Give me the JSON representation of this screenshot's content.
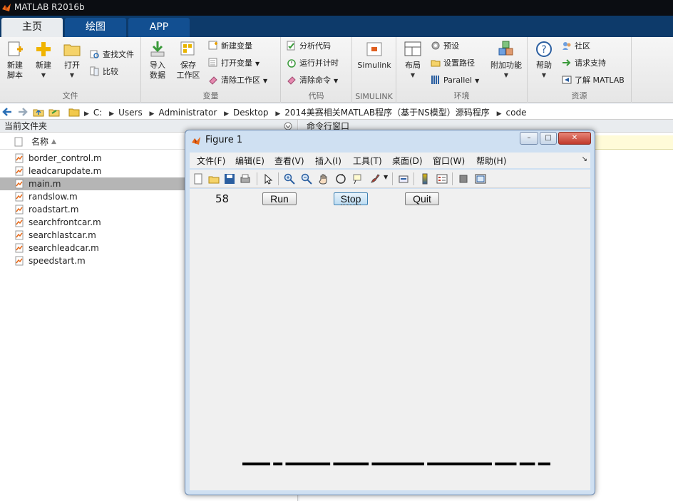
{
  "window": {
    "title": "MATLAB R2016b"
  },
  "tabs": [
    {
      "label": "主页",
      "active": true
    },
    {
      "label": "绘图",
      "active": false
    },
    {
      "label": "APP",
      "active": false
    }
  ],
  "ribbon": {
    "file_group": {
      "label": "文件",
      "new_script": "新建\n脚本",
      "new": "新建",
      "open": "打开",
      "find_files": "查找文件",
      "compare": "比较"
    },
    "variable_group": {
      "label": "变量",
      "import": "导入\n数据",
      "save_ws": "保存\n工作区",
      "new_var": "新建变量",
      "open_var": "打开变量",
      "clear_ws": "清除工作区"
    },
    "code_group": {
      "label": "代码",
      "analyze": "分析代码",
      "run_time": "运行并计时",
      "clear_cmd": "清除命令"
    },
    "simulink_group": {
      "label": "SIMULINK",
      "simulink": "Simulink"
    },
    "env_group": {
      "label": "环境",
      "layout": "布局",
      "prefs": "预设",
      "set_path": "设置路径",
      "parallel": "Parallel",
      "addons": "附加功能"
    },
    "resources_group": {
      "label": "资源",
      "help": "帮助",
      "community": "社区",
      "support": "请求支持",
      "learn": "了解 MATLAB"
    }
  },
  "address": {
    "segments": [
      "C:",
      "Users",
      "Administrator",
      "Desktop",
      "2014美赛相关MATLAB程序（基于NS模型）源码程序",
      "code"
    ]
  },
  "folder_panel": {
    "title": "当前文件夹",
    "col_name": "名称",
    "files": [
      {
        "name": "border_control.m",
        "selected": false
      },
      {
        "name": "leadcarupdate.m",
        "selected": false
      },
      {
        "name": "main.m",
        "selected": true
      },
      {
        "name": "randslow.m",
        "selected": false
      },
      {
        "name": "roadstart.m",
        "selected": false
      },
      {
        "name": "searchfrontcar.m",
        "selected": false
      },
      {
        "name": "searchlastcar.m",
        "selected": false
      },
      {
        "name": "searchleadcar.m",
        "selected": false
      },
      {
        "name": "speedstart.m",
        "selected": false
      }
    ]
  },
  "command_window": {
    "title": "命令行窗口"
  },
  "figure": {
    "title": "Figure 1",
    "menus": [
      "文件(F)",
      "编辑(E)",
      "查看(V)",
      "插入(I)",
      "工具(T)",
      "桌面(D)",
      "窗口(W)",
      "帮助(H)"
    ],
    "counter": "58",
    "buttons": {
      "run": "Run",
      "stop": "Stop",
      "quit": "Quit"
    },
    "road_segments": [
      {
        "x0": 0.0,
        "x1": 0.09
      },
      {
        "x0": 0.1,
        "x1": 0.13
      },
      {
        "x0": 0.14,
        "x1": 0.285
      },
      {
        "x0": 0.295,
        "x1": 0.41
      },
      {
        "x0": 0.42,
        "x1": 0.59
      },
      {
        "x0": 0.6,
        "x1": 0.81
      },
      {
        "x0": 0.82,
        "x1": 0.89
      },
      {
        "x0": 0.9,
        "x1": 0.95
      },
      {
        "x0": 0.96,
        "x1": 1.0
      }
    ]
  },
  "colors": {
    "tab_bar": "#0d3a6a",
    "tab": "#124f91",
    "selected_row": "#b5b5b5",
    "figure_frame": "#cfe0f2",
    "close_button": "#c0392b"
  }
}
